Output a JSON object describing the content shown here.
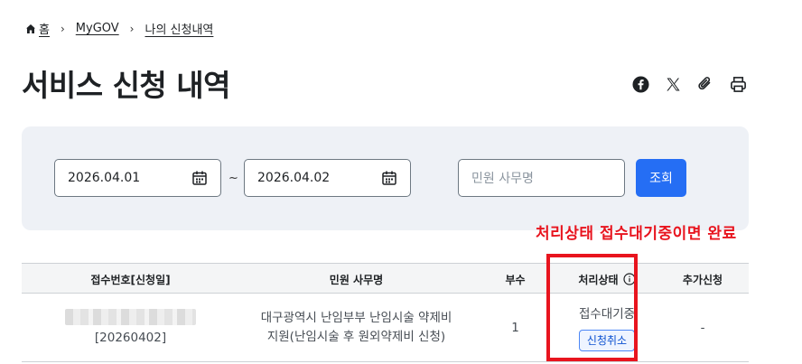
{
  "breadcrumb": {
    "home": "홈",
    "items": [
      "MyGOV",
      "나의 신청내역"
    ]
  },
  "page_title": "서비스 신청 내역",
  "share_icons": [
    "facebook-icon",
    "x-icon",
    "link-clip-icon",
    "print-icon"
  ],
  "search": {
    "start_date": "2026.04.01",
    "end_date": "2026.04.02",
    "range_sep": "~",
    "keyword_placeholder": "민원 사무명",
    "submit_label": "조회"
  },
  "annotation": "처리상태 접수대기중이면 완료",
  "table": {
    "headers": [
      "접수번호[신청일]",
      "민원 사무명",
      "부수",
      "처리상태",
      "추가신청"
    ],
    "rows": [
      {
        "receipt_date": "[20260402]",
        "service_name_line1": "대구광역시 난임부부 난임시술 약제비",
        "service_name_line2": "지원(난임시술 후 원외약제비 신청)",
        "copies": "1",
        "status": "접수대기중",
        "action_label": "신청취소",
        "additional": "-"
      }
    ]
  },
  "colors": {
    "primary": "#256ef4",
    "annotation": "#e8141e",
    "panel": "#eef1f6"
  }
}
